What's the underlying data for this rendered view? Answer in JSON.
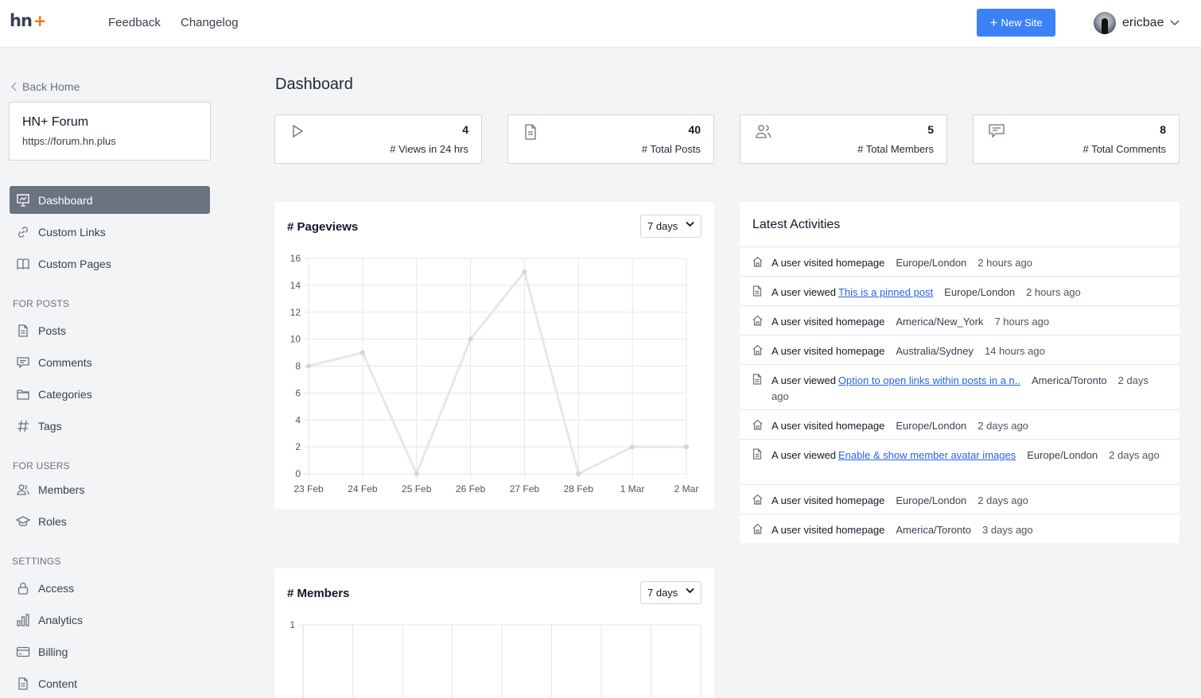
{
  "header": {
    "logo_text": "hn",
    "logo_plus": "+",
    "nav": [
      "Feedback",
      "Changelog"
    ],
    "new_site_label": "New Site",
    "user_name": "ericbae"
  },
  "sidebar": {
    "back_label": "Back Home",
    "site_name": "HN+ Forum",
    "site_url": "https://forum.hn.plus",
    "items": [
      {
        "label": "Dashboard",
        "icon": "presentation-chart-icon",
        "active": true
      },
      {
        "label": "Custom Links",
        "icon": "link-icon"
      },
      {
        "label": "Custom Pages",
        "icon": "book-icon"
      }
    ],
    "posts_heading": "FOR POSTS",
    "posts_items": [
      {
        "label": "Posts",
        "icon": "document-icon"
      },
      {
        "label": "Comments",
        "icon": "comment-icon"
      },
      {
        "label": "Categories",
        "icon": "folder-icon"
      },
      {
        "label": "Tags",
        "icon": "hashtag-icon"
      }
    ],
    "users_heading": "FOR USERS",
    "users_items": [
      {
        "label": "Members",
        "icon": "users-icon"
      },
      {
        "label": "Roles",
        "icon": "graduation-cap-icon"
      }
    ],
    "settings_heading": "SETTINGS",
    "settings_items": [
      {
        "label": "Access",
        "icon": "lock-icon"
      },
      {
        "label": "Analytics",
        "icon": "bar-chart-icon"
      },
      {
        "label": "Billing",
        "icon": "credit-card-icon"
      },
      {
        "label": "Content",
        "icon": "document-icon"
      }
    ]
  },
  "main": {
    "title": "Dashboard",
    "stats": [
      {
        "value": "4",
        "label": "# Views in 24 hrs",
        "icon": "play-icon"
      },
      {
        "value": "40",
        "label": "# Total Posts",
        "icon": "document-icon"
      },
      {
        "value": "5",
        "label": "# Total Members",
        "icon": "users-icon"
      },
      {
        "value": "8",
        "label": "# Total Comments",
        "icon": "comment-icon"
      }
    ],
    "pageviews_title": "# Pageviews",
    "pageviews_range": "7 days",
    "members_title": "# Members",
    "members_range": "7 days"
  },
  "activities": {
    "title": "Latest Activities",
    "rows": [
      {
        "icon": "home-icon",
        "text": "A user visited homepage",
        "link": "",
        "location": "Europe/London",
        "time": "2 hours ago"
      },
      {
        "icon": "document-icon",
        "text": "A user viewed",
        "link": "This is a pinned post",
        "location": "Europe/London",
        "time": "2 hours ago"
      },
      {
        "icon": "home-icon",
        "text": "A user visited homepage",
        "link": "",
        "location": "America/New_York",
        "time": "7 hours ago"
      },
      {
        "icon": "home-icon",
        "text": "A user visited homepage",
        "link": "",
        "location": "Australia/Sydney",
        "time": "14 hours ago"
      },
      {
        "icon": "document-icon",
        "text": "A user viewed",
        "link": "Option to open links within posts in a n..",
        "location": "America/Toronto",
        "time": "2 days ago"
      },
      {
        "icon": "home-icon",
        "text": "A user visited homepage",
        "link": "",
        "location": "Europe/London",
        "time": "2 days ago"
      },
      {
        "icon": "document-icon",
        "text": "A user viewed",
        "link": "Enable & show member avatar images",
        "location": "Europe/London",
        "time": "2 days ago"
      },
      {
        "icon": "home-icon",
        "text": "A user visited homepage",
        "link": "",
        "location": "Europe/London",
        "time": "2 days ago"
      },
      {
        "icon": "home-icon",
        "text": "A user visited homepage",
        "link": "",
        "location": "America/Toronto",
        "time": "3 days ago"
      }
    ]
  },
  "chart_data": [
    {
      "type": "line",
      "title": "# Pageviews",
      "categories": [
        "23 Feb",
        "24 Feb",
        "25 Feb",
        "26 Feb",
        "27 Feb",
        "28 Feb",
        "1 Mar",
        "2 Mar"
      ],
      "values": [
        8,
        9,
        0,
        10,
        15,
        0,
        2,
        2
      ],
      "ylim": [
        0,
        16
      ],
      "yticks": [
        "0",
        "2",
        "4",
        "6",
        "8",
        "10",
        "12",
        "14",
        "16"
      ],
      "grid": true,
      "color": "#e5e7eb"
    },
    {
      "type": "bar",
      "title": "# Members",
      "yticks": [
        "1"
      ],
      "grid": true
    }
  ]
}
